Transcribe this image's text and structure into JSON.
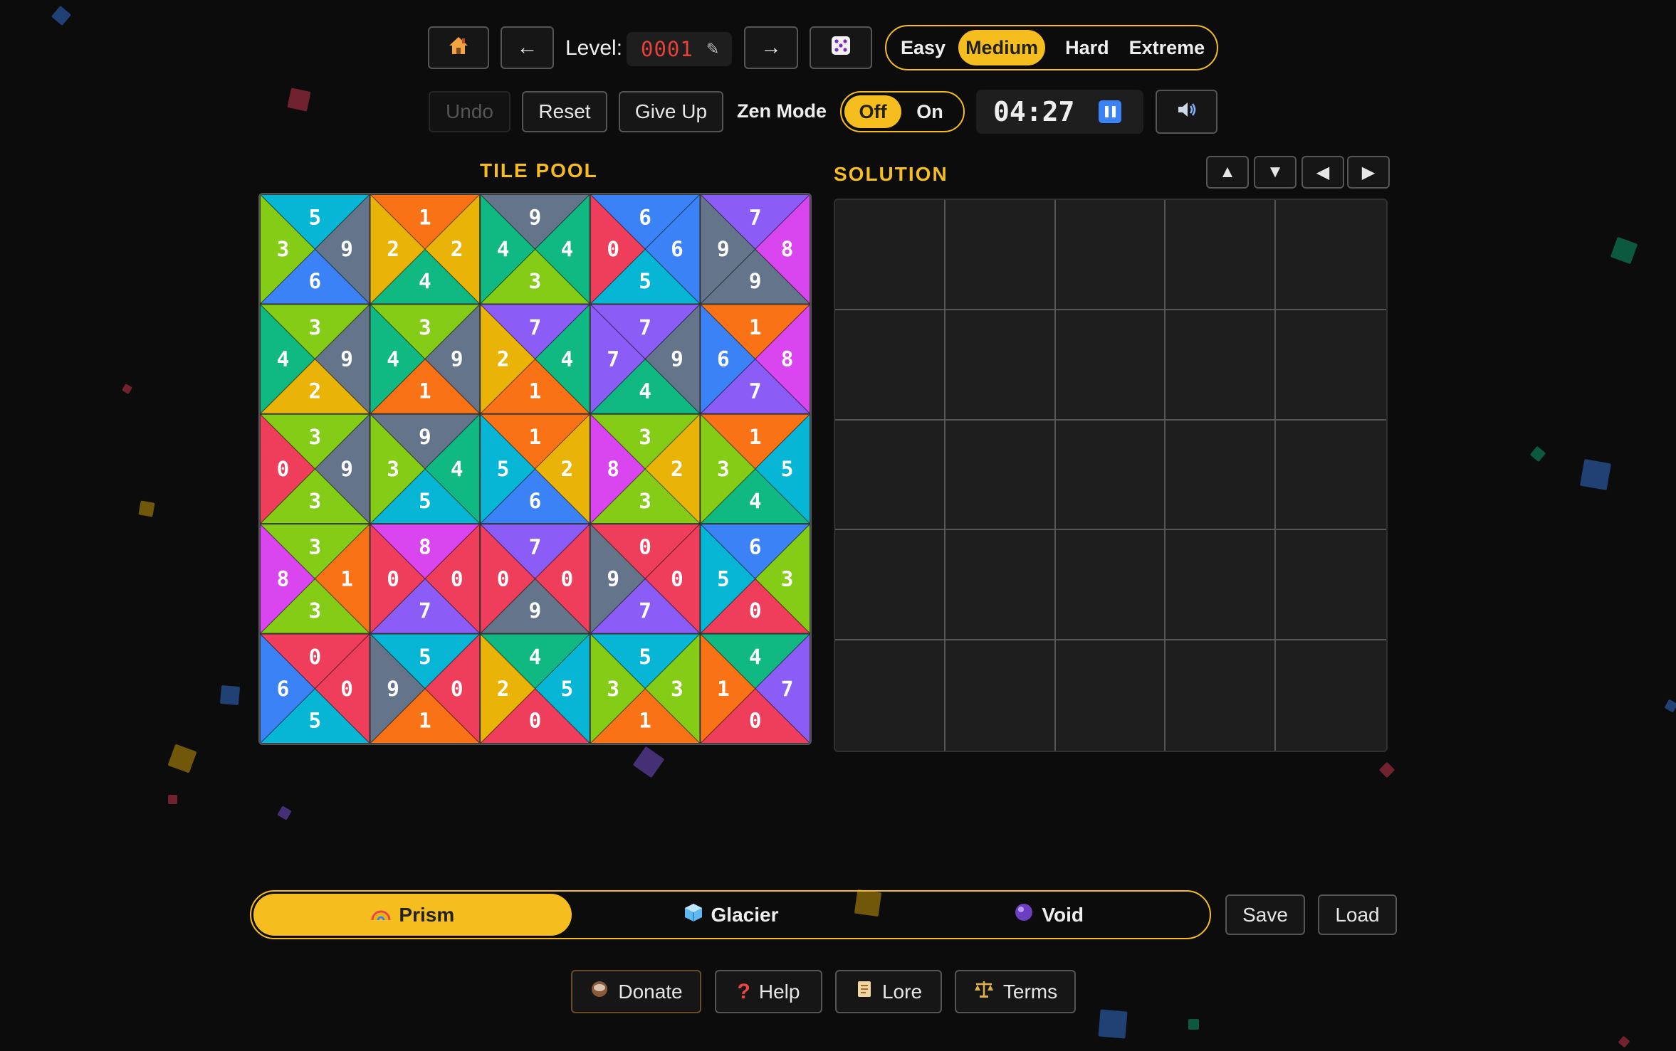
{
  "header": {
    "home_icon": "house-icon",
    "prev_arrow": "←",
    "next_arrow": "→",
    "level_label": "Level:",
    "level_value": "0001",
    "edit_icon": "✎",
    "random_icon": "dice-icon"
  },
  "difficulty": {
    "options": [
      "Easy",
      "Medium",
      "Hard",
      "Extreme"
    ],
    "selected": "Medium"
  },
  "controls": {
    "undo": "Undo",
    "reset": "Reset",
    "give_up": "Give Up",
    "zen_label": "Zen Mode",
    "zen_off": "Off",
    "zen_on": "On",
    "zen_selected": "Off",
    "timer": "04:27",
    "pause_icon": "pause-icon",
    "sound_icon": "speaker-icon"
  },
  "tile_pool": {
    "title": "TILE POOL",
    "digit_colors": {
      "0": "#ee3e5b",
      "1": "#f97316",
      "2": "#eab308",
      "3": "#84cc16",
      "4": "#10b981",
      "5": "#06b6d4",
      "6": "#3b82f6",
      "7": "#8b5cf6",
      "8": "#d946ef",
      "9": "#64748b"
    },
    "rows": [
      [
        [
          5,
          9,
          6,
          3
        ],
        [
          1,
          2,
          4,
          2
        ],
        [
          9,
          4,
          3,
          4
        ],
        [
          6,
          6,
          5,
          0
        ],
        [
          7,
          8,
          9,
          9
        ]
      ],
      [
        [
          3,
          9,
          2,
          4
        ],
        [
          3,
          9,
          1,
          4
        ],
        [
          7,
          4,
          1,
          2
        ],
        [
          7,
          9,
          4,
          7
        ],
        [
          1,
          8,
          7,
          6
        ]
      ],
      [
        [
          3,
          9,
          3,
          0
        ],
        [
          9,
          4,
          5,
          3
        ],
        [
          1,
          2,
          6,
          5
        ],
        [
          3,
          2,
          3,
          8
        ],
        [
          1,
          5,
          4,
          3
        ]
      ],
      [
        [
          3,
          1,
          3,
          8
        ],
        [
          8,
          0,
          7,
          0
        ],
        [
          7,
          0,
          9,
          0
        ],
        [
          0,
          0,
          7,
          9
        ],
        [
          6,
          3,
          0,
          5
        ]
      ],
      [
        [
          0,
          0,
          5,
          6
        ],
        [
          5,
          0,
          1,
          9
        ],
        [
          4,
          5,
          0,
          2
        ],
        [
          5,
          3,
          1,
          3
        ],
        [
          4,
          7,
          0,
          1
        ]
      ]
    ]
  },
  "solution": {
    "title": "SOLUTION",
    "rows": 5,
    "cols": 5,
    "shift_buttons": [
      "▲",
      "▼",
      "◀",
      "▶"
    ]
  },
  "themes": {
    "options": [
      {
        "label": "Prism",
        "icon": "rainbow-icon"
      },
      {
        "label": "Glacier",
        "icon": "ice-cube-icon"
      },
      {
        "label": "Void",
        "icon": "purple-orb-icon"
      }
    ],
    "selected": "Prism"
  },
  "storage": {
    "save": "Save",
    "load": "Load"
  },
  "footer": {
    "donate": "Donate",
    "help": "Help",
    "lore": "Lore",
    "terms": "Terms"
  }
}
